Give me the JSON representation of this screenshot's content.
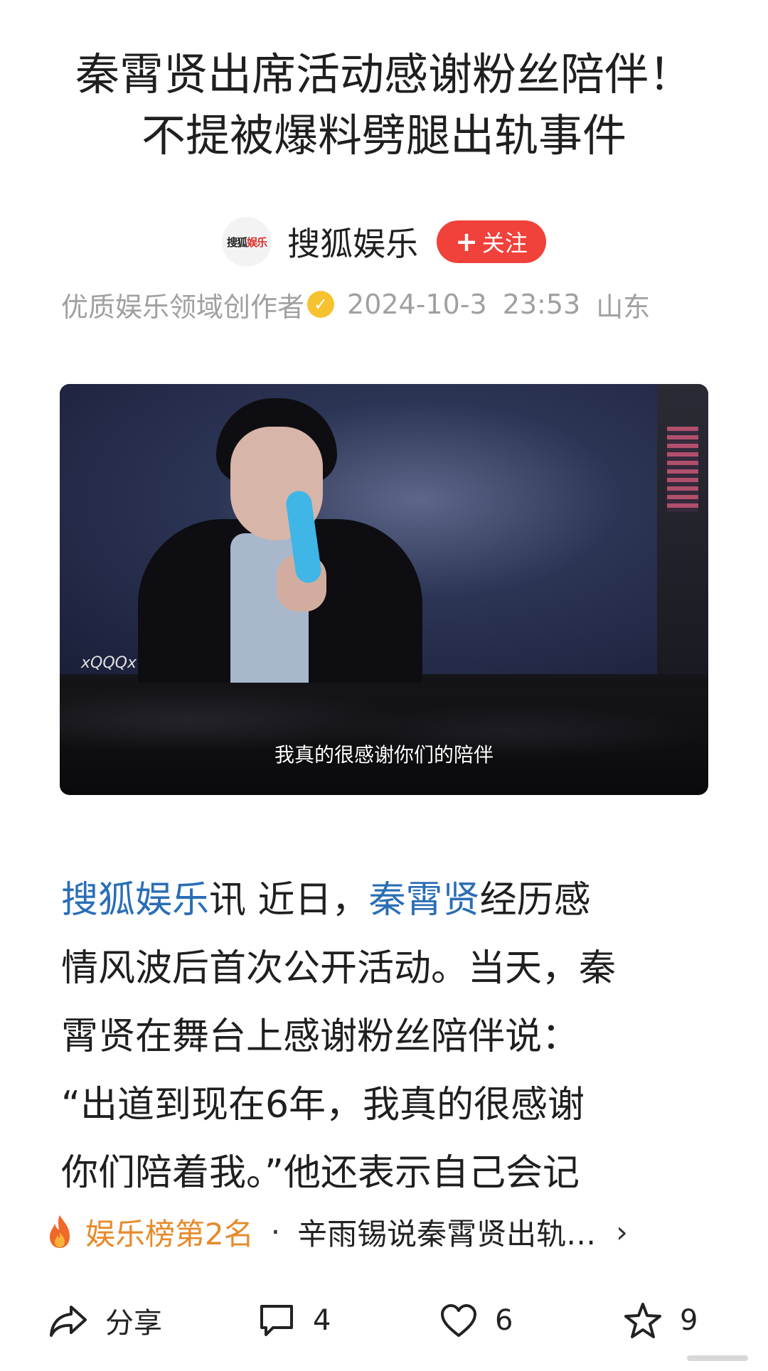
{
  "article": {
    "title_line1": "秦霄贤出席活动感谢粉丝陪伴！",
    "title_line2": "不提被爆料劈腿出轨事件",
    "author": {
      "logo_text_a": "搜狐",
      "logo_text_b": "娱乐",
      "name": "搜狐娱乐",
      "follow_label": "关注",
      "description": "优质娱乐领域创作者",
      "date": "2024-10-3",
      "time": "23:53",
      "location": "山东"
    },
    "image": {
      "watermark": "xQQQx",
      "subtitle": "我真的很感谢你们的陪伴"
    },
    "body": {
      "l1_link1": "搜狐娱乐",
      "l1_text1": "讯 近日，",
      "l1_link2": "秦霄贤",
      "l1_text2": "经历感",
      "l2": "情风波后首次公开活动。当天，秦",
      "l3": "霄贤在舞台上感谢粉丝陪伴说：",
      "l4": "“出道到现在6年，我真的很感谢",
      "l5": "你们陪着我。”他还表示自己会记"
    }
  },
  "rank_bar": {
    "label": "娱乐榜第2名",
    "separator": "·",
    "topic": "辛雨锡说秦霄贤出轨…",
    "chevron": "›"
  },
  "actions": {
    "share_label": "分享",
    "comment_count": "4",
    "like_count": "6",
    "favorite_count": "9"
  },
  "colors": {
    "link": "#2a6eb6",
    "follow": "#f0413a",
    "rank": "#e78a2a"
  }
}
